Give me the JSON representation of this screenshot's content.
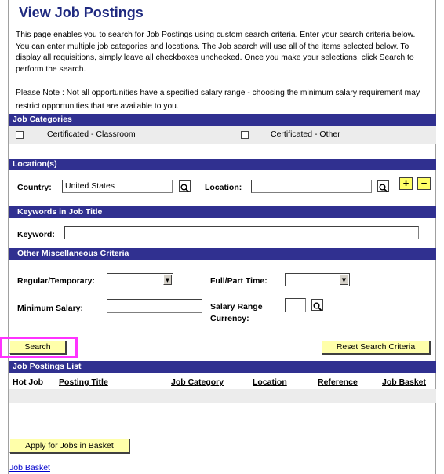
{
  "page": {
    "title": "View Job Postings",
    "intro": "This page enables you to search for Job Postings using custom search criteria. Enter your search criteria below. You can enter multiple job categories and locations. The Job search will use all of the items selected below. To display all requisitions, simply leave all checkboxes unchecked. Once you make your selections, click Search to perform the search.",
    "note": "Please Note : Not all opportunities have a specified salary range - choosing the minimum salary requirement may restrict opportunities that are available to you."
  },
  "job_categories": {
    "header": "Job Categories",
    "items": [
      {
        "label": "Certificated - Classroom",
        "checked": false
      },
      {
        "label": "Certificated - Other",
        "checked": false
      }
    ]
  },
  "locations": {
    "header": "Location(s)",
    "country_label": "Country:",
    "country_value": "United States",
    "location_label": "Location:",
    "location_value": "",
    "add_label": "+",
    "remove_label": "−"
  },
  "keywords": {
    "header": "Keywords in Job Title",
    "keyword_label": "Keyword:",
    "keyword_value": ""
  },
  "misc": {
    "header": "Other Miscellaneous Criteria",
    "regular_temporary_label": "Regular/Temporary:",
    "regular_temporary_value": "",
    "full_part_time_label": "Full/Part Time:",
    "full_part_time_value": "",
    "minimum_salary_label": "Minimum Salary:",
    "minimum_salary_value": "",
    "salary_range_label_1": "Salary Range",
    "salary_range_label_2": "Currency:",
    "currency_value": ""
  },
  "actions": {
    "search_label": "Search",
    "reset_label": "Reset Search Criteria",
    "highlight_color": "#ff33ff"
  },
  "postings": {
    "header": "Job Postings List",
    "columns": [
      "Hot Job",
      "Posting Title",
      "Job Category",
      "Location",
      "Reference",
      "Job Basket"
    ],
    "rows": []
  },
  "footer": {
    "apply_label": "Apply for Jobs in Basket",
    "job_basket_link": "Job Basket"
  },
  "colors": {
    "header_bar": "#303090",
    "title": "#1f2a80",
    "button": "#ffffaa",
    "panel": "#ececec"
  }
}
